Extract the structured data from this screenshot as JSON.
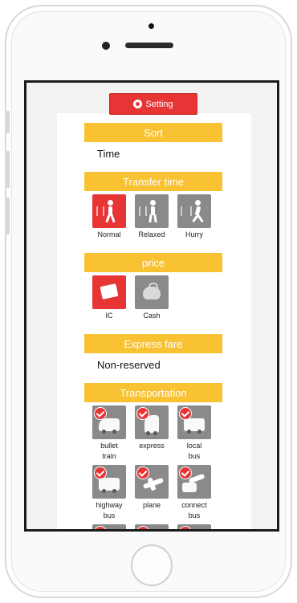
{
  "toolbar": {
    "setting_label": "Setting"
  },
  "sections": {
    "sort": {
      "title": "Sort",
      "value": "Time"
    },
    "transfer_time": {
      "title": "Transfer time",
      "options": [
        {
          "label": "Normal",
          "selected": true,
          "icon": "walking-normal-icon"
        },
        {
          "label": "Relaxed",
          "selected": false,
          "icon": "walking-relaxed-icon"
        },
        {
          "label": "Hurry",
          "selected": false,
          "icon": "walking-hurry-icon"
        }
      ]
    },
    "price": {
      "title": "price",
      "options": [
        {
          "label": "IC",
          "selected": true,
          "icon": "ic-card-icon"
        },
        {
          "label": "Cash",
          "selected": false,
          "icon": "coin-purse-icon"
        }
      ]
    },
    "express_fare": {
      "title": "Express fare",
      "value": "Non-reserved"
    },
    "transportation": {
      "title": "Transportation",
      "options": [
        {
          "label": "bullet\ntrain",
          "checked": true,
          "icon": "bullet-train-icon"
        },
        {
          "label": "express",
          "checked": true,
          "icon": "express-train-icon"
        },
        {
          "label": "local\nbus",
          "checked": true,
          "icon": "local-bus-icon"
        },
        {
          "label": "highway\nbus",
          "checked": true,
          "icon": "highway-bus-icon"
        },
        {
          "label": "plane",
          "checked": true,
          "icon": "plane-icon"
        },
        {
          "label": "connect\nbus",
          "checked": true,
          "icon": "connect-bus-icon"
        }
      ]
    }
  },
  "colors": {
    "accent_red": "#e73536",
    "section_yellow": "#f8c232",
    "tile_gray": "#8a8a8a"
  }
}
